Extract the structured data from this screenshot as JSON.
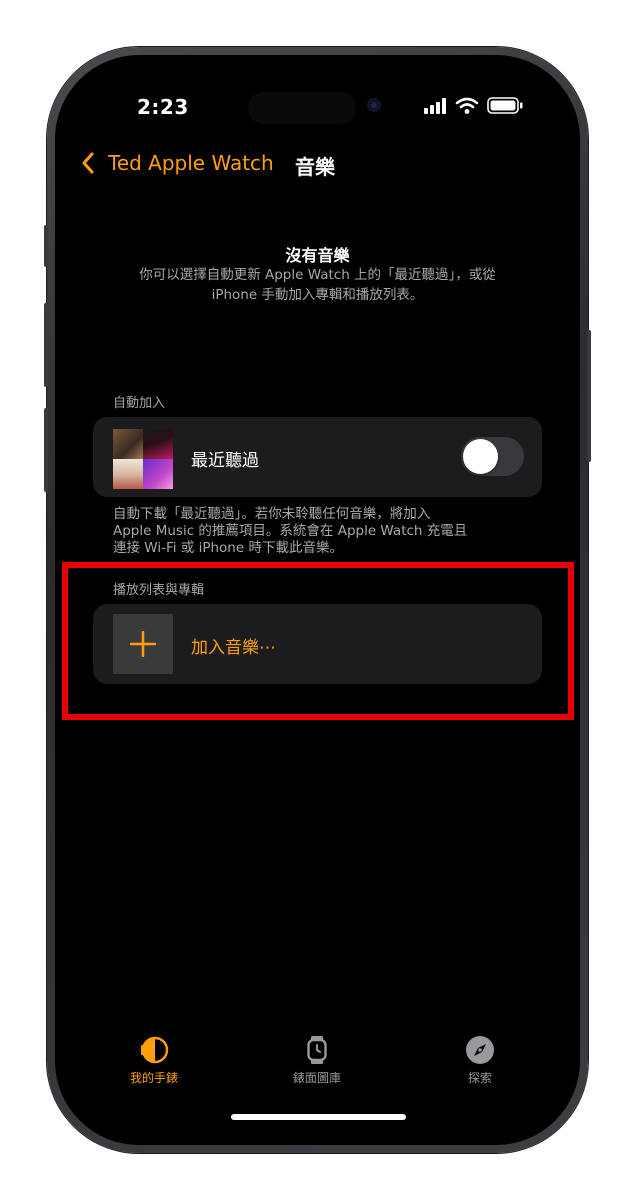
{
  "status_bar": {
    "time": "2:23"
  },
  "nav": {
    "back_label": "Ted Apple Watch",
    "title": "音樂"
  },
  "empty_state": {
    "title": "沒有音樂",
    "description_line1": "你可以選擇自動更新 Apple Watch 上的「最近聽過」，或從",
    "description_line2": "iPhone 手動加入專輯和播放列表。"
  },
  "auto_add": {
    "section_label": "自動加入",
    "item_label": "最近聽過",
    "toggle_on": false,
    "footnote_line1": "自動下載「最近聽過」。若你未聆聽任何音樂，將加入",
    "footnote_line2": "Apple Music 的推薦項目。系統會在 Apple Watch 充電且",
    "footnote_line3": "連接 Wi-Fi 或 iPhone 時下載此音樂。"
  },
  "playlists": {
    "section_label": "播放列表與專輯",
    "add_label": "加入音樂⋯"
  },
  "tab_bar": {
    "tabs": [
      {
        "label": "我的手錶",
        "icon": "watch-side-icon",
        "active": true
      },
      {
        "label": "錶面圖庫",
        "icon": "watch-face-icon",
        "active": false
      },
      {
        "label": "探索",
        "icon": "compass-icon",
        "active": false
      }
    ]
  },
  "colors": {
    "accent": "#ff9f0a",
    "highlight": "#e60000",
    "card": "#1c1c1e"
  }
}
